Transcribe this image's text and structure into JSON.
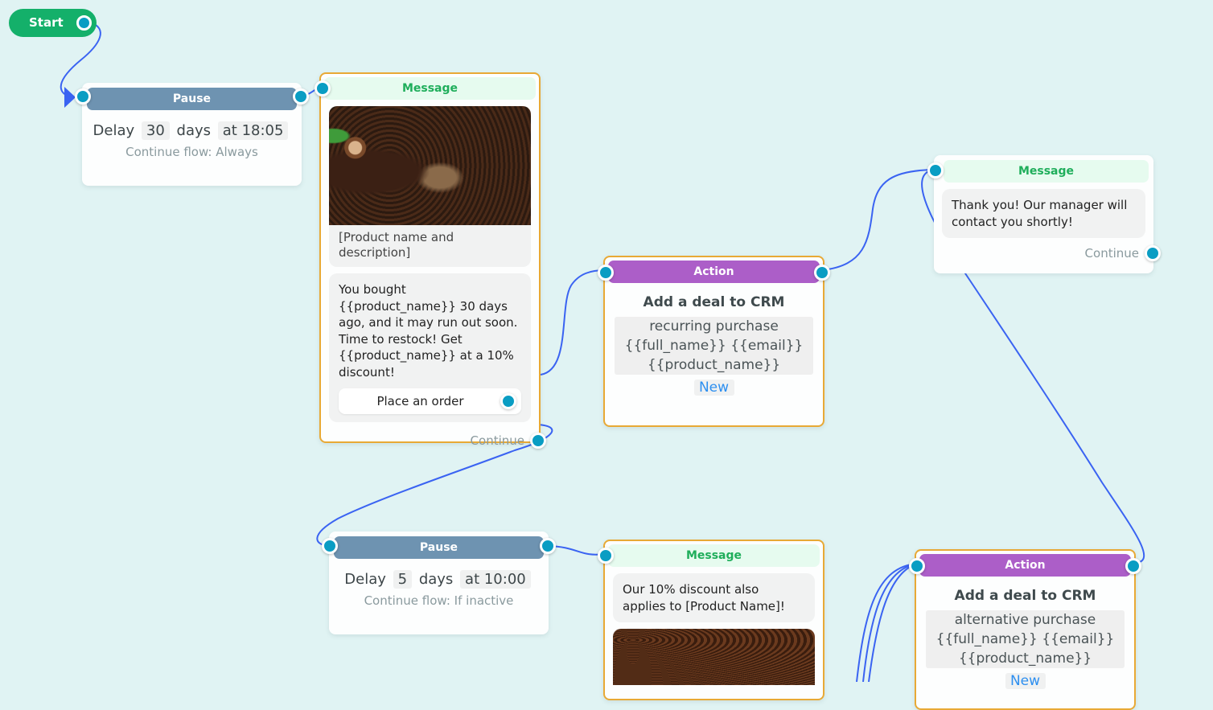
{
  "start": {
    "label": "Start"
  },
  "pause1": {
    "header": "Pause",
    "delay_label": "Delay",
    "delay_value": "30",
    "unit": "days",
    "time": "at 18:05",
    "continue_flow": "Continue flow: Always"
  },
  "message1": {
    "header": "Message",
    "image": "coffee-beans-turkish-pot-image",
    "caption": "[Product name and description]",
    "text": "You bought {{product_name}} 30 days ago, and it may run out soon. Time to restock! Get {{product_name}} at a 10% discount!",
    "button": "Place an order",
    "continue": "Continue"
  },
  "action1": {
    "header": "Action",
    "title": "Add a deal to CRM",
    "details": [
      "recurring purchase",
      "{{full_name}} {{email}}",
      "{{product_name}}"
    ],
    "status": "New"
  },
  "message2": {
    "header": "Message",
    "text": "Thank you! Our manager will contact you shortly!",
    "continue": "Continue"
  },
  "pause2": {
    "header": "Pause",
    "delay_label": "Delay",
    "delay_value": "5",
    "unit": "days",
    "time": "at 10:00",
    "continue_flow": "Continue flow: If inactive"
  },
  "message3": {
    "header": "Message",
    "text": "Our 10% discount also applies to [Product Name]!",
    "image": "coffee-beans-image"
  },
  "action2": {
    "header": "Action",
    "title": "Add a deal to CRM",
    "details": [
      "alternative purchase",
      "{{full_name}} {{email}}",
      "{{product_name}}"
    ],
    "status": "New"
  },
  "colors": {
    "canvas": "#e0f3f3",
    "link": "#3a63f2",
    "port": "#0a9dc3",
    "start": "#14b06a",
    "pause_header": "#6e93b1",
    "action_header": "#ac5ec8",
    "message_header_text": "#1fae5b",
    "selected_border": "#e8a935",
    "status_new": "#2d8ff0"
  }
}
